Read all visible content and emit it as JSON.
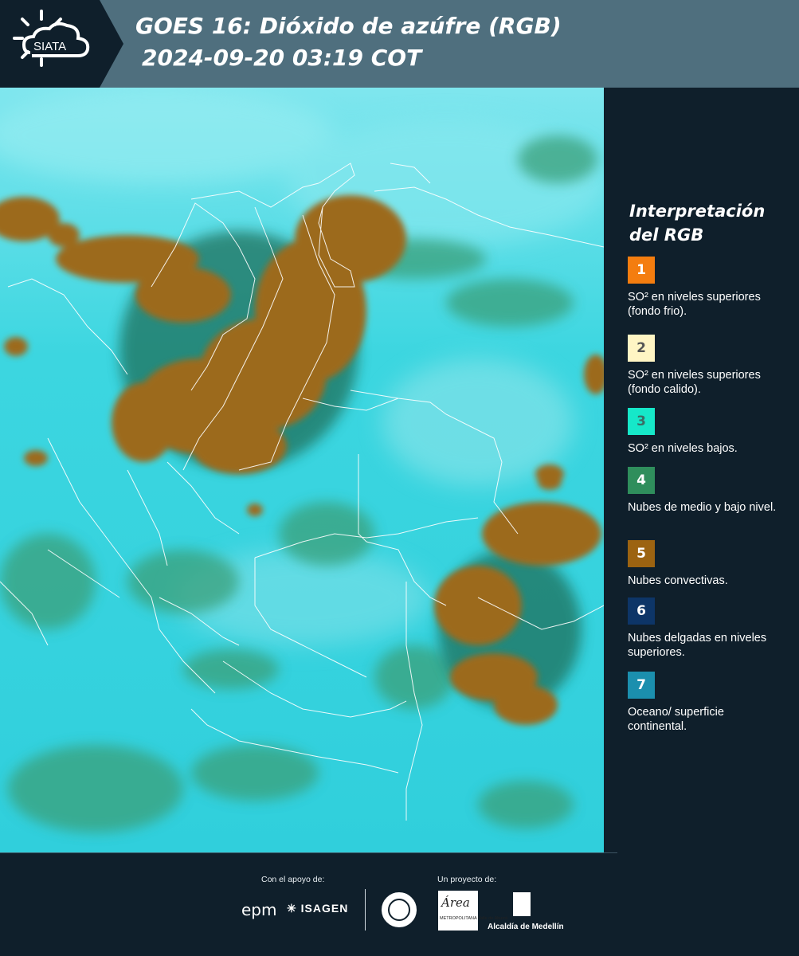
{
  "header": {
    "logo_text": "SIATA",
    "title_line1": "GOES 16: Dióxido de azúfre (RGB)",
    "title_line2": "2024-09-20 03:19 COT"
  },
  "legend": {
    "title_line1": "Interpretación",
    "title_line2": "del RGB",
    "items": [
      {
        "number": "1",
        "label": "SO² en niveles superiores (fondo frio).",
        "color": "#f47d0f",
        "text_color": "#ffffff"
      },
      {
        "number": "2",
        "label": "SO² en niveles superiores (fondo calido).",
        "color": "#fff5c4",
        "text_color": "#555555"
      },
      {
        "number": "3",
        "label": "SO² en niveles bajos.",
        "color": "#16e8c9",
        "text_color": "#3a6e66"
      },
      {
        "number": "4",
        "label": "Nubes de medio y bajo nivel.",
        "color": "#2f8e5c",
        "text_color": "#ffffff"
      },
      {
        "number": "5",
        "label": "Nubes convectivas.",
        "color": "#9c6311",
        "text_color": "#ffffff"
      },
      {
        "number": "6",
        "label": "Nubes delgadas en niveles superiores.",
        "color": "#0d3567",
        "text_color": "#ffffff"
      },
      {
        "number": "7",
        "label": "Oceano/ superficie continental.",
        "color": "#1b8fae",
        "text_color": "#ffffff"
      }
    ]
  },
  "footer": {
    "support_label": "Con el apoyo de:",
    "project_label": "Un proyecto de:",
    "epm": "epm",
    "isagen": "ISAGEN",
    "area_logo": "Área",
    "area_sub": "METROPOLITANA Valle de Aburrá",
    "alcaldia": "Alcaldía de Medellín"
  },
  "map": {
    "ocean_color": "#2ed4de",
    "cloud_color": "#9c6a1e",
    "low_cloud_color": "#3aa07a"
  }
}
